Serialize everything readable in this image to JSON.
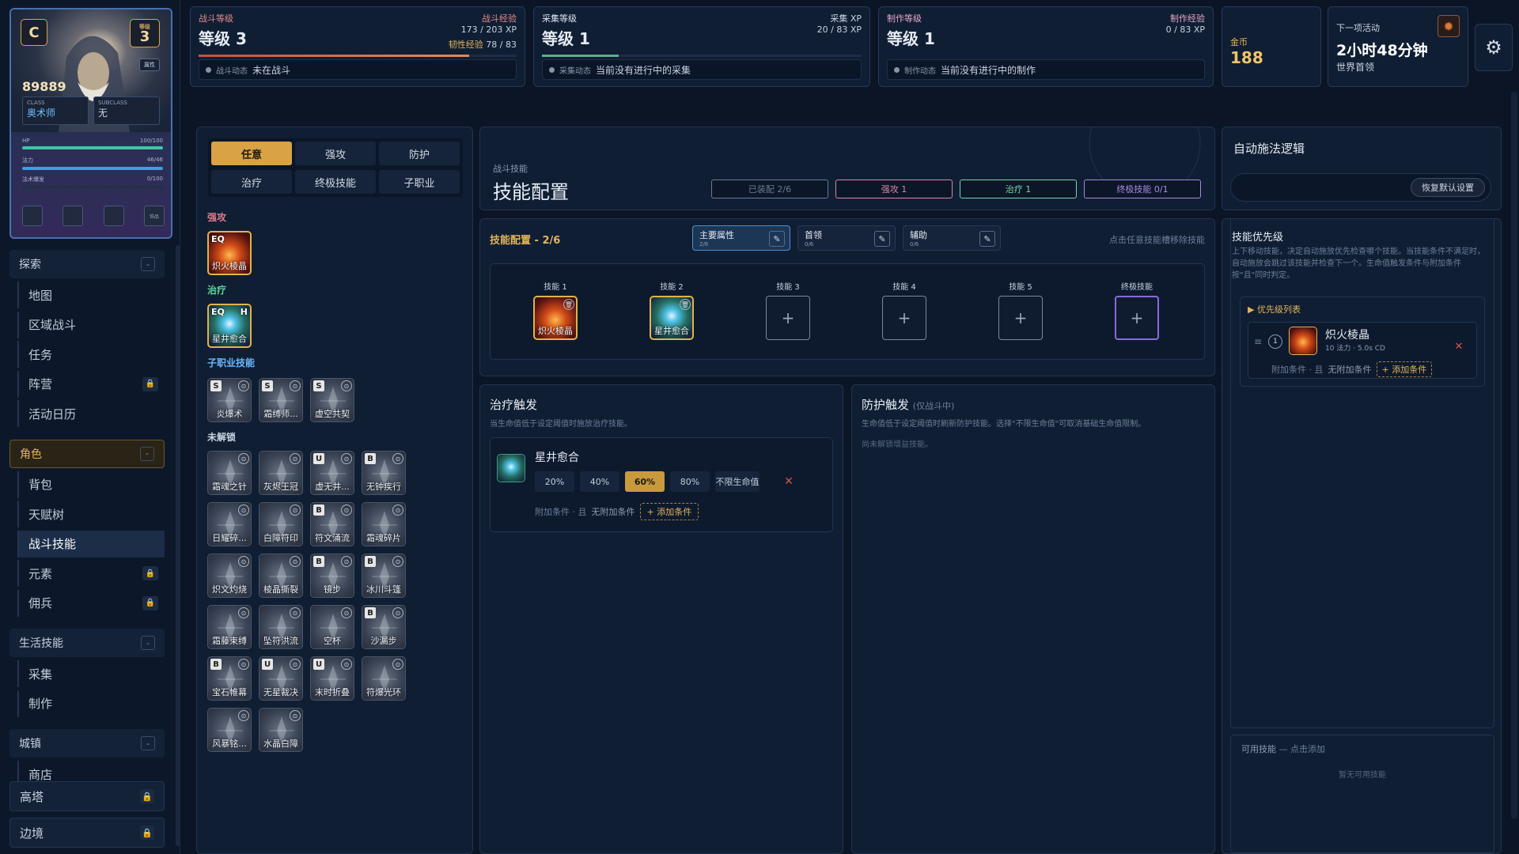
{
  "character": {
    "rank": "C",
    "level_badge_label": "等级",
    "level": "3",
    "gold_points": "89889",
    "class_label": "CLASS",
    "class_value": "奥术师",
    "subclass_label": "SUBCLASS",
    "subclass_value": "无",
    "hp_label": "HP",
    "hp_text": "100/100",
    "hp_fill": 1.0,
    "mana_label": "法力",
    "mana_text": "46/46",
    "mana_fill": 1.0,
    "burst_label": "法术爆发",
    "burst_text": "0/100",
    "burst_fill": 0.0,
    "small_btn": "属性",
    "slot_labels": [
      "",
      "",
      "",
      "饰品"
    ]
  },
  "nav": {
    "sections": [
      {
        "title": "探索",
        "toggle": "-",
        "items": [
          {
            "label": "地图"
          },
          {
            "label": "区域战斗"
          },
          {
            "label": "任务"
          },
          {
            "label": "阵营",
            "locked": true
          },
          {
            "label": "活动日历"
          }
        ]
      },
      {
        "title": "角色",
        "toggle": "-",
        "items": [
          {
            "label": "背包"
          },
          {
            "label": "天赋树"
          },
          {
            "label": "战斗技能",
            "active": true
          },
          {
            "label": "元素",
            "locked": true
          },
          {
            "label": "佣兵",
            "locked": true
          }
        ]
      },
      {
        "title": "生活技能",
        "toggle": "-",
        "items": [
          {
            "label": "采集"
          },
          {
            "label": "制作"
          }
        ]
      },
      {
        "title": "城镇",
        "toggle": "-",
        "items": [
          {
            "label": "商店"
          }
        ]
      }
    ],
    "locked_sections": [
      "高塔",
      "边境"
    ],
    "lock_glyph": "🔒"
  },
  "top": {
    "combat": {
      "label": "战斗等级",
      "level": "等级 3",
      "xp_label": "战斗经验",
      "xp": "173 / 203 XP",
      "xp_fill": 0.85,
      "toughness_label": "韧性经验",
      "toughness": "78 / 83",
      "status_label": "战斗动态",
      "status": "未在战斗"
    },
    "gather": {
      "label": "采集等级",
      "level": "等级 1",
      "xp_label": "采集 XP",
      "xp": "20 / 83 XP",
      "xp_fill": 0.24,
      "status_label": "采集动态",
      "status": "当前没有进行中的采集"
    },
    "craft": {
      "label": "制作等级",
      "level": "等级 1",
      "xp_label": "制作经验",
      "xp": "0 / 83 XP",
      "xp_fill": 0.0,
      "status_label": "制作动态",
      "status": "当前没有进行中的制作"
    },
    "gold": {
      "label": "金币",
      "value": "188"
    },
    "next_event": {
      "label": "下一项活动",
      "time": "2小时48分钟",
      "name": "世界首领"
    }
  },
  "skill_list": {
    "tabs": [
      "任意",
      "强攻",
      "防护",
      "治疗",
      "终极技能",
      "子职业"
    ],
    "active_tab": "任意",
    "cat_attack": "强攻",
    "cat_heal": "治疗",
    "cat_subclass": "子职业技能",
    "cat_locked": "未解锁",
    "attack_skills": [
      {
        "name": "炽火棱晶",
        "eq": "EQ"
      }
    ],
    "heal_skills": [
      {
        "name": "星井愈合",
        "eq": "EQ",
        "tag": "H"
      }
    ],
    "subclass_skills": [
      {
        "name": "炎爆术",
        "tier": "S"
      },
      {
        "name": "霜缚师...",
        "tier": "S"
      },
      {
        "name": "虚空共契",
        "tier": "S"
      }
    ],
    "locked_skills": [
      {
        "name": "霜魂之针",
        "tier": ""
      },
      {
        "name": "灰烬王冠",
        "tier": ""
      },
      {
        "name": "虚无井...",
        "tier": "U"
      },
      {
        "name": "无钟疾行",
        "tier": "B"
      },
      {
        "name": "日耀碎...",
        "tier": ""
      },
      {
        "name": "白障符印",
        "tier": ""
      },
      {
        "name": "符文涌流",
        "tier": "B"
      },
      {
        "name": "霜魂碎片",
        "tier": ""
      },
      {
        "name": "炽文灼烧",
        "tier": ""
      },
      {
        "name": "棱晶撕裂",
        "tier": ""
      },
      {
        "name": "镜步",
        "tier": "B"
      },
      {
        "name": "冰川斗篷",
        "tier": "B"
      },
      {
        "name": "霜藤束缚",
        "tier": ""
      },
      {
        "name": "坠符洪流",
        "tier": ""
      },
      {
        "name": "空杯",
        "tier": ""
      },
      {
        "name": "沙漏步",
        "tier": "B"
      },
      {
        "name": "宝石帷幕",
        "tier": "B"
      },
      {
        "name": "无星裁决",
        "tier": "U"
      },
      {
        "name": "末时折叠",
        "tier": "U"
      },
      {
        "name": "符爆光环",
        "tier": ""
      },
      {
        "name": "风暴铭...",
        "tier": ""
      },
      {
        "name": "水晶白障",
        "tier": ""
      }
    ]
  },
  "config_header": {
    "subtitle": "战斗技能",
    "title": "技能配置",
    "chips": [
      {
        "label": "已装配 2/6",
        "color": "#6b7b94"
      },
      {
        "label": "强攻 1",
        "color": "#d58aa8"
      },
      {
        "label": "治疗 1",
        "color": "#7fd3a6"
      },
      {
        "label": "终极技能 0/1",
        "color": "#a78be0"
      }
    ]
  },
  "loadout": {
    "title": "技能配置 - 2/6",
    "presets": [
      {
        "name": "主要属性",
        "count": "2/6",
        "active": true
      },
      {
        "name": "首领",
        "count": "0/6"
      },
      {
        "name": "辅助",
        "count": "0/6"
      }
    ],
    "hint": "点击任意技能槽移除技能",
    "slots": [
      {
        "label": "技能 1",
        "skill": "炽火棱晶",
        "kind": "fire"
      },
      {
        "label": "技能 2",
        "skill": "星井愈合",
        "kind": "heal"
      },
      {
        "label": "技能 3",
        "skill": "",
        "kind": "empty"
      },
      {
        "label": "技能 4",
        "skill": "",
        "kind": "empty"
      },
      {
        "label": "技能 5",
        "skill": "",
        "kind": "empty"
      },
      {
        "label": "终极技能",
        "skill": "",
        "kind": "ult"
      }
    ],
    "plus": "+"
  },
  "heal_trigger": {
    "title": "治疗触发",
    "desc": "当生命值低于设定阈值时施放治疗技能。",
    "skill": "星井愈合",
    "thresholds": [
      "20%",
      "40%",
      "60%",
      "80%",
      "不限生命值"
    ],
    "selected": "60%",
    "cond_prefix": "附加条件 · 且",
    "cond_none": "无附加条件",
    "add_cond": "+ 添加条件",
    "remove": "✕"
  },
  "protect_trigger": {
    "title": "防护触发",
    "title_note": "(仅战斗中)",
    "desc": "生命值低于设定阈值时刷新防护技能。选择\"不限生命值\"可取消基础生命值限制。",
    "empty": "尚未解锁增益技能。"
  },
  "auto": {
    "title": "自动施法逻辑",
    "reset": "恢复默认设置",
    "priority_title": "技能优先级",
    "priority_desc": "上下移动技能，决定自动施放优先检查哪个技能。当技能条件不满足时，自动施放会跳过该技能并检查下一个。生命值触发条件与附加条件按\"且\"同时判定。",
    "list_title": "▶ 优先级列表",
    "entry": {
      "index": "1",
      "name": "炽火棱晶",
      "meta": "10 法力 · 5.0s CD",
      "cond_prefix": "附加条件 · 且",
      "cond_none": "无附加条件",
      "add_cond": "+ 添加条件",
      "remove": "✕"
    },
    "available_title": "可用技能",
    "available_hint": "— 点击添加",
    "available_empty": "暂无可用技能"
  },
  "colors": {
    "accent_gold": "#d8a245",
    "hp": "#3fc7a5",
    "mana": "#3aa0e0"
  }
}
